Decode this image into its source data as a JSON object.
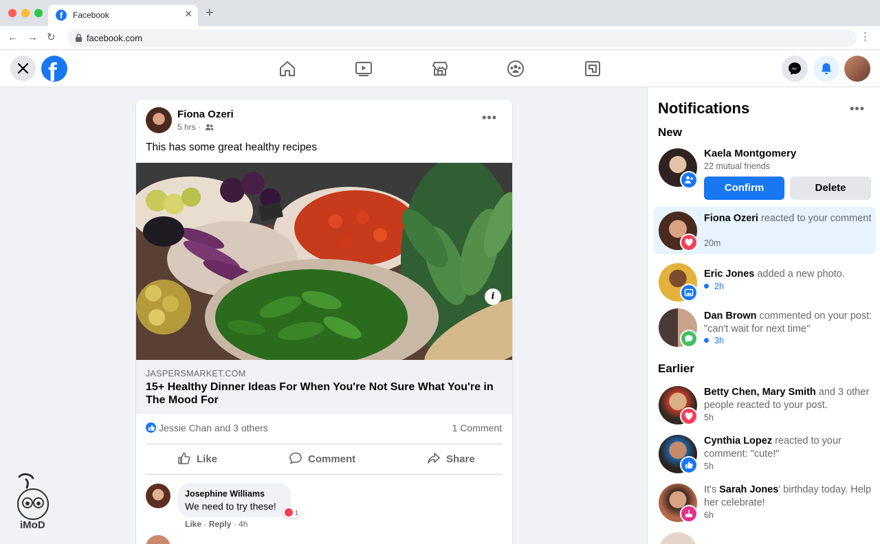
{
  "browser": {
    "tab_title": "Facebook",
    "url": "facebook.com"
  },
  "fb": {
    "brand_color": "#1877f2",
    "nav": [
      "home-icon",
      "watch-icon",
      "marketplace-icon",
      "groups-icon",
      "gaming-icon"
    ]
  },
  "post": {
    "author": "Fiona Ozeri",
    "time": "5 hrs ·",
    "text": "This has some great healthy recipes",
    "link_domain": "JASPERSMARKET.COM",
    "link_title": "15+ Healthy Dinner Ideas For When You're Not Sure What You're in The Mood For",
    "reactions": "Jessie Chan and 3 others",
    "comments_count": "1 Comment",
    "actions": {
      "like": "Like",
      "comment": "Comment",
      "share": "Share"
    },
    "comment": {
      "author": "Josephine Williams",
      "text": "We need to try these!",
      "reaction_count": "1",
      "like": "Like",
      "reply": "Reply",
      "time": "· 4h"
    }
  },
  "notifications": {
    "title": "Notifications",
    "new_label": "New",
    "earlier_label": "Earlier",
    "request": {
      "name": "Kaela Montgomery",
      "mutual": "22 mutual friends",
      "confirm": "Confirm",
      "delete": "Delete"
    },
    "new_items": [
      {
        "name": "Fiona Ozeri",
        "rest": " reacted to your comment",
        "time": "20m"
      },
      {
        "name": "Eric Jones",
        "rest": " added a new photo.",
        "time": "2h"
      },
      {
        "name": "Dan Brown",
        "rest": " commented on your post: \"can't wait for next time\"",
        "time": "3h"
      }
    ],
    "earlier_items": [
      {
        "name": "Betty Chen, Mary Smith",
        "rest": " and 3 other people reacted to your post.",
        "time": "5h"
      },
      {
        "name": "Cynthia Lopez",
        "rest": " reacted to your comment: \"cute!\"",
        "time": "5h"
      },
      {
        "pre": "It's ",
        "name": "Sarah Jones",
        "rest": "' birthday today. Help her celebrate!",
        "time": "6h"
      }
    ]
  },
  "watermark": {
    "text": "iMoD"
  }
}
